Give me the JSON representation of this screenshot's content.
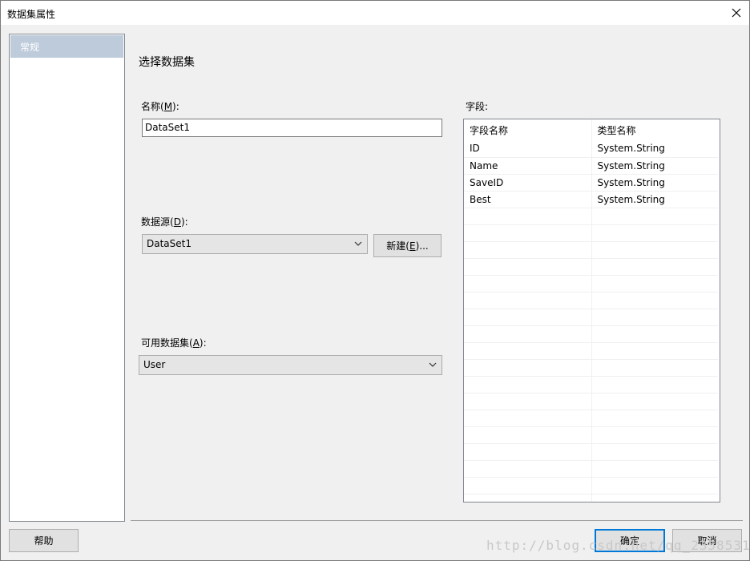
{
  "window": {
    "title": "数据集属性"
  },
  "nav": {
    "items": [
      {
        "label": "常规"
      }
    ]
  },
  "section": {
    "title": "选择数据集"
  },
  "name_field": {
    "label_prefix": "名称(",
    "label_key": "M",
    "label_suffix": "):",
    "value": "DataSet1"
  },
  "datasource": {
    "label_prefix": "数据源(",
    "label_key": "D",
    "label_suffix": "):",
    "selected": "DataSet1",
    "new_prefix": "新建(",
    "new_key": "E",
    "new_suffix": ")..."
  },
  "available": {
    "label_prefix": "可用数据集(",
    "label_key": "A",
    "label_suffix": "):",
    "selected": "User"
  },
  "fields": {
    "label": "字段:",
    "columns": [
      "字段名称",
      "类型名称"
    ],
    "rows": [
      [
        "ID",
        "System.String"
      ],
      [
        "Name",
        "System.String"
      ],
      [
        "SaveID",
        "System.String"
      ],
      [
        "Best",
        "System.String"
      ]
    ]
  },
  "footer": {
    "help": "帮助",
    "ok": "确定",
    "cancel": "取消"
  },
  "watermark": "http://blog.csdn.net/qq_23585313"
}
